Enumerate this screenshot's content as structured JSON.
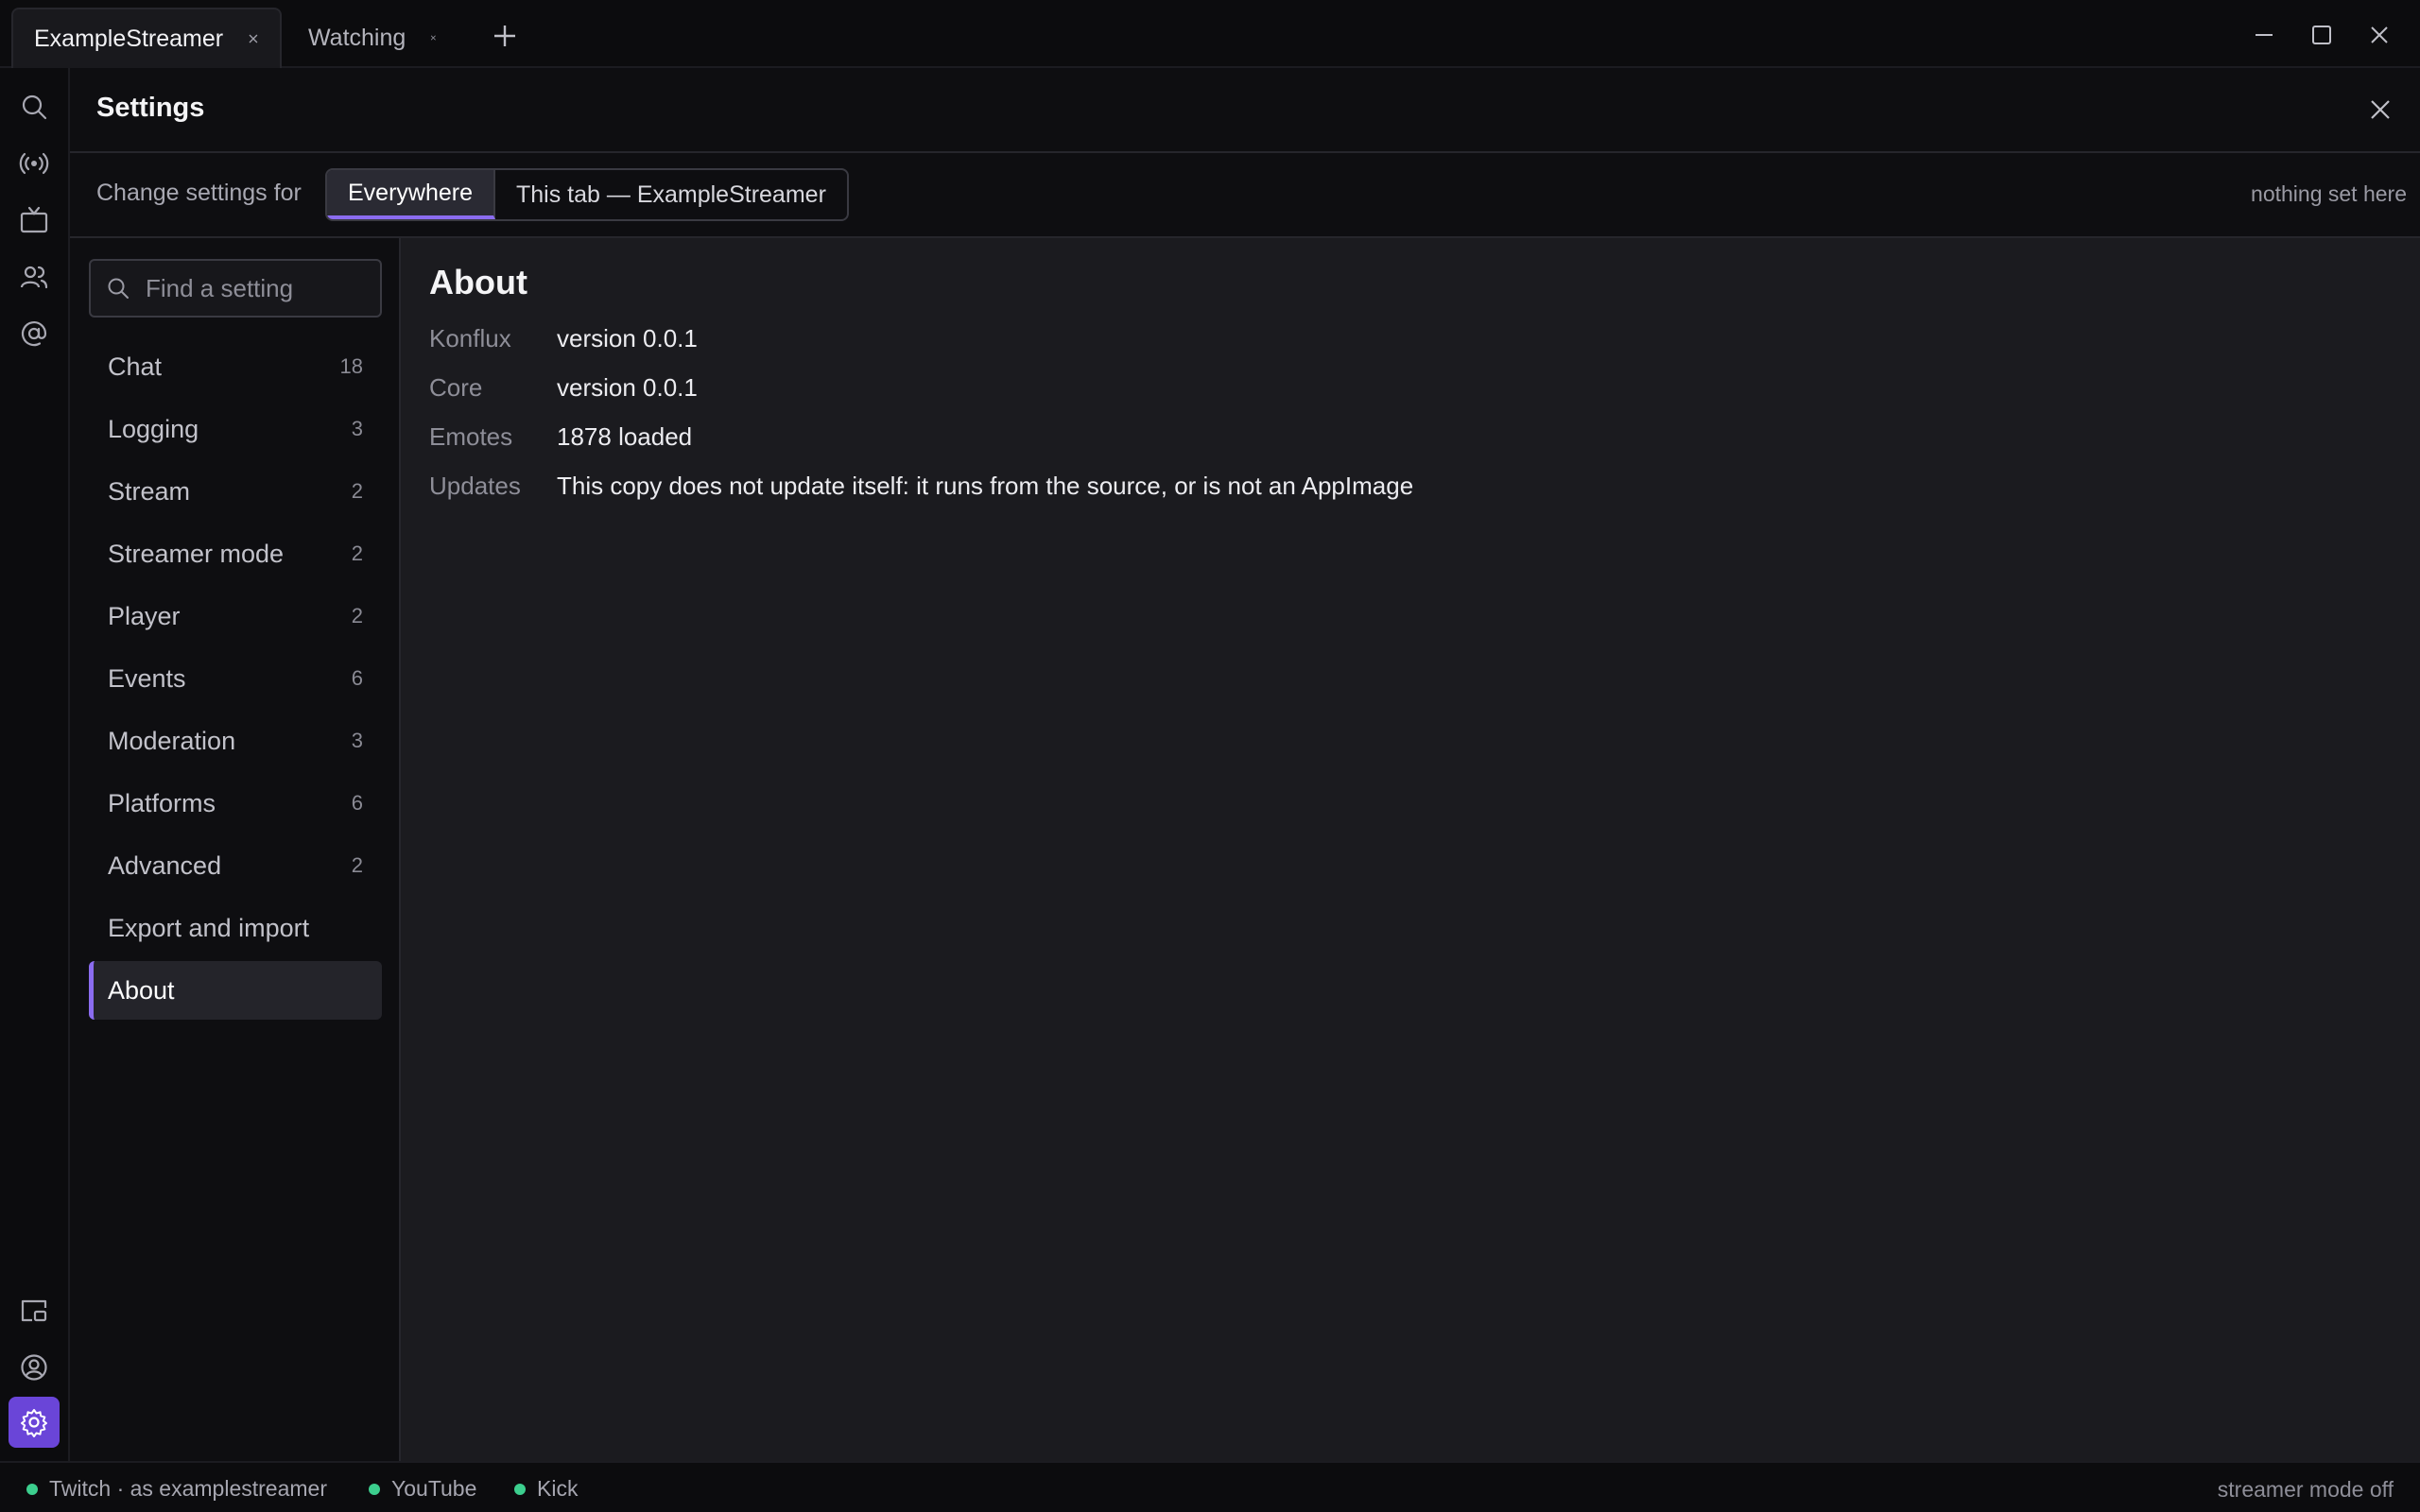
{
  "tabs": [
    {
      "label": "ExampleStreamer",
      "active": true
    },
    {
      "label": "Watching",
      "active": false
    }
  ],
  "icons": {
    "search": "search-icon",
    "live": "broadcast-icon",
    "tv": "tv-icon",
    "users": "users-icon",
    "mentions": "at-sign-icon",
    "popout": "popout-window-icon",
    "account": "account-icon",
    "settings": "gear-icon"
  },
  "settings": {
    "title": "Settings",
    "scope_label": "Change settings for",
    "scope_options": [
      "Everywhere",
      "This tab — ExampleStreamer"
    ],
    "scope_selected": "Everywhere",
    "scope_status": "nothing set here",
    "search_placeholder": "Find a setting",
    "nav": [
      {
        "label": "Chat",
        "count": "18"
      },
      {
        "label": "Logging",
        "count": "3"
      },
      {
        "label": "Stream",
        "count": "2"
      },
      {
        "label": "Streamer mode",
        "count": "2"
      },
      {
        "label": "Player",
        "count": "2"
      },
      {
        "label": "Events",
        "count": "6"
      },
      {
        "label": "Moderation",
        "count": "3"
      },
      {
        "label": "Platforms",
        "count": "6"
      },
      {
        "label": "Advanced",
        "count": "2"
      },
      {
        "label": "Export and import",
        "count": ""
      },
      {
        "label": "About",
        "count": ""
      }
    ],
    "active_nav": "About"
  },
  "about": {
    "title": "About",
    "rows": [
      {
        "key": "Konflux",
        "value": "version 0.0.1"
      },
      {
        "key": "Core",
        "value": "version 0.0.1"
      },
      {
        "key": "Emotes",
        "value": "1878 loaded"
      },
      {
        "key": "Updates",
        "value": "This copy does not update itself: it runs from the source, or is not an AppImage"
      }
    ]
  },
  "statusbar": {
    "platforms": [
      {
        "label": "Twitch · as examplestreamer",
        "status_color": "#3ccf8e"
      },
      {
        "label": "YouTube",
        "status_color": "#3ccf8e"
      },
      {
        "label": "Kick",
        "status_color": "#3ccf8e"
      }
    ],
    "streamer_mode": "streamer mode off"
  },
  "colors": {
    "accent": "#8b6cf0",
    "accent_solid": "#6a45d8",
    "online": "#3ccf8e"
  }
}
